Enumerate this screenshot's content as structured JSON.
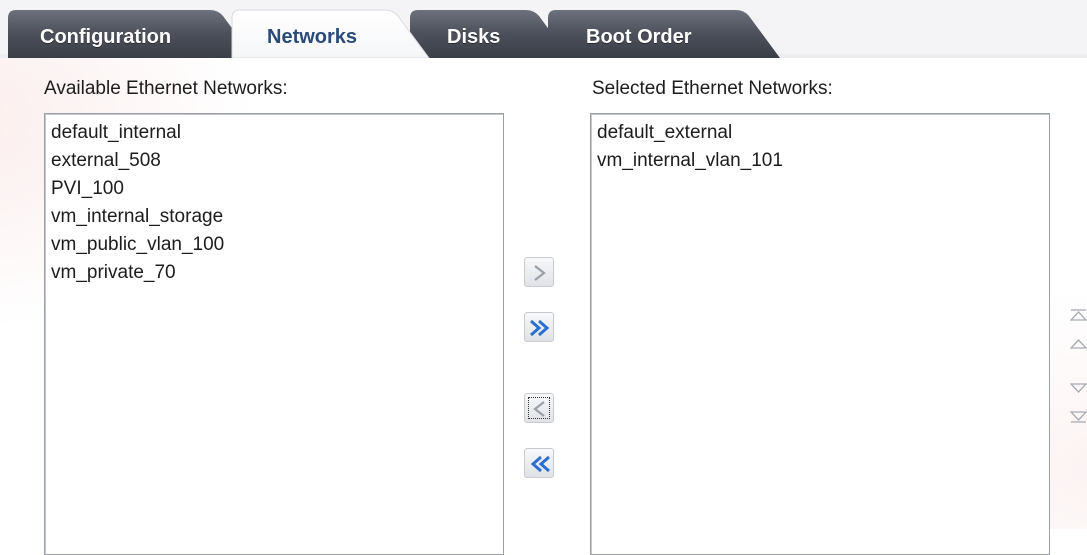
{
  "tabs": [
    {
      "label": "Configuration",
      "active": false
    },
    {
      "label": "Networks",
      "active": true
    },
    {
      "label": "Disks",
      "active": false
    },
    {
      "label": "Boot Order",
      "active": false
    }
  ],
  "available": {
    "label": "Available Ethernet Networks:",
    "items": [
      "default_internal",
      "external_508",
      "PVI_100",
      "vm_internal_storage",
      "vm_public_vlan_100",
      "vm_private_70"
    ]
  },
  "selected": {
    "label": "Selected Ethernet Networks:",
    "items": [
      "default_external",
      "vm_internal_vlan_101"
    ]
  },
  "shuttle_buttons": [
    {
      "name": "move-selected",
      "icon": "chevron-right-icon",
      "enabled": false
    },
    {
      "name": "move-all",
      "icon": "double-chevron-right-icon",
      "enabled": true
    },
    {
      "name": "remove-selected",
      "icon": "chevron-left-icon",
      "enabled": false
    },
    {
      "name": "remove-all",
      "icon": "double-chevron-left-icon",
      "enabled": true
    }
  ],
  "reorder_buttons": [
    {
      "name": "move-top",
      "icon": "move-to-top-icon",
      "enabled": false
    },
    {
      "name": "move-up",
      "icon": "move-up-icon",
      "enabled": false
    },
    {
      "name": "move-down",
      "icon": "move-down-icon",
      "enabled": false
    },
    {
      "name": "move-bottom",
      "icon": "move-to-bottom-icon",
      "enabled": false
    }
  ],
  "colors": {
    "tab_dark": "#4a505c",
    "tab_active": "#ffffff",
    "tab_active_text": "#2a4a7a",
    "button_icon_enabled": "#2b6fd1",
    "button_icon_disabled": "#9aa0a8"
  }
}
